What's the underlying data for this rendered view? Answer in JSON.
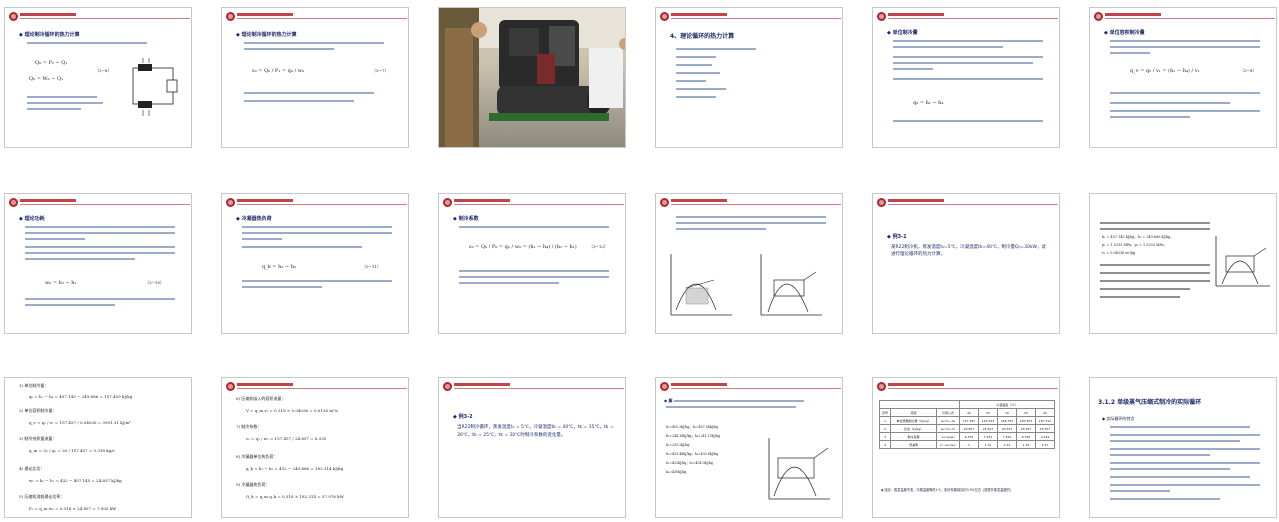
{
  "slides": [
    {
      "id": 1,
      "title": "◆ 理论制冷循环的热力计算",
      "eqs": [
        "Q₀ = P₂ − Q₁",
        "Q₀ = W₀ − Q₁",
        "（3−6）"
      ]
    },
    {
      "id": 2,
      "title": "◆ 理论制冷循环的热力计算",
      "eqs": [
        "ε₀ = Q₀ / P₁ = q₀ / w₀",
        "（3−7）"
      ]
    },
    {
      "id": 3,
      "title": ""
    },
    {
      "id": 4,
      "title": "4、理论循环的热力计算"
    },
    {
      "id": 5,
      "title": "◆ 单位制冷量",
      "eqs": [
        "q₀ = h₁ − h₄"
      ]
    },
    {
      "id": 6,
      "title": "◆ 单位容积制冷量",
      "eqs": [
        "q_v = q₀ / v₁ = (h₁ − h₄) / v₁",
        "（3−8）"
      ]
    },
    {
      "id": 7,
      "title": "◆ 理论功耗",
      "eqs": [
        "w₀ = h₂ − h₁",
        "（3−10）"
      ]
    },
    {
      "id": 8,
      "title": "◆ 冷凝器热负荷",
      "eqs": [
        "q_k = h₂ − h₃",
        "（3−11）"
      ]
    },
    {
      "id": 9,
      "title": "◆ 制冷系数",
      "eqs": [
        "ε₀ = Q₀ / P₀ = q₀ / w₀ = (h₁ − h₄) / (h₂ − h₁)",
        "（3−12）"
      ]
    },
    {
      "id": 10,
      "title": ""
    },
    {
      "id": 11,
      "title": "◆ 例3-1",
      "body": "某R22制冷机，蒸发温度t₀=5℃，冷凝温度tk=40℃，制冷量Q₀=30kW，试进行理论循环的热力计算。"
    },
    {
      "id": 12,
      "title": "",
      "eqs": [
        "h₁ = 407.145 kJ/kg，h₃ = 249.686 kJ/kg，",
        "p₁ = 1.5335 MPa，p₂ = 1.5335 MPa，",
        "v₁ = 0.04036 m³/kg"
      ]
    },
    {
      "id": 13,
      "title": "",
      "eqs": [
        "1) 单位制冷量：",
        "q₀ = h₁ − h₄ = 407.145 − 249.686 = 157.459 kJ/kg",
        "2) 单位容积制冷量：",
        "q_v = q₀ / v₁ = 157.457 / 0.04036 = 3901.31 kJ/m³",
        "3) 制冷剂质量流量：",
        "q_m = Q₀ / q₀ = 30 / 157.457 = 0.318 kg/s",
        "4) 理论比功：",
        "w₀ = h₂ − h₁ = 432 − 407.145 = 24.857 kJ/kg",
        "5) 压缩机消耗理论功率：",
        "P₀ = q_m w₀ = 0.318 × 24.857 = 7.905 kW"
      ]
    },
    {
      "id": 14,
      "title": "",
      "eqs": [
        "6) 压缩机吸入的容积流量：",
        "V = q_m v₁ = 0.318 × 0.04036 = 0.0128 m³/s",
        "7) 制冷系数：",
        "ε₀ = q₀ / w₀ = 157.457 / 24.857 = 6.335",
        "8) 冷凝器单位热负荷：",
        "q_k = h₂ − h₃ = 432 − 249.686 = 182.314 kJ/kg",
        "9) 冷凝器热负荷：",
        "Q_k = q_m q_k = 0.318 × 182.314 = 57.976 kW"
      ]
    },
    {
      "id": 15,
      "title": "◆ 例3-2",
      "body": "当R22制冷循环，蒸发温度t₀ = 5℃，冷凝温度tk = 40℃，tk = 35℃，tk = 30℃，tk = 25℃，tk = 20℃时制冷系数的变化量。"
    },
    {
      "id": 16,
      "title": "◆ 解",
      "eqs": [
        "h₂=405.3kJ/kg；h₁=407.04kJ/kg",
        "h₃=244.16kJ/kg；h₄=241.15kJ/kg",
        "h₂=239.2kJ/kg",
        "h₃=429.46kJ/kg；h₄=430.6kJ/kg",
        "h₂=432kJ/kg；h₃=434.9kJ/kg",
        "h₄=430kJ/kg"
      ]
    },
    {
      "id": 17,
      "title": "",
      "table": {
        "header_top": [
          "冷凝温度（℃）"
        ],
        "header": [
          "序号",
          "项目",
          "计算公式",
          "40",
          "35",
          "30",
          "25",
          "20"
        ],
        "rows": [
          [
            "1",
            "单位质量制冷量（kJ/kg）",
            "q₀=h₁−h₄",
            "157.457",
            "163.193",
            "168.752",
            "180.353",
            "187.312"
          ],
          [
            "2",
            "比功（kJ/kg）",
            "w₀=h₂−h₁",
            "24.857",
            "22.407",
            "20.347",
            "18.357",
            "16.357"
          ],
          [
            "3",
            "制冷系数",
            "ε₀=q₀/w₀",
            "6.335",
            "7.261",
            "7.462",
            "8.765",
            "9.249"
          ],
          [
            "4",
            "增减率",
            "(ε−ε₄₀)/ε₄₀",
            "1",
            "1.15",
            "1.22",
            "1.34",
            "1.47"
          ]
        ],
        "note": "◆ 结论：蒸发温度不变，冷凝温度降低1℃，制冷系数增加约3.5%左右（是提升蒸发温度的）"
      }
    },
    {
      "id": 18,
      "title": "3.1.2  单级蒸气压缩式制冷的实际循环",
      "sub": "◆ 实际循环的特点"
    }
  ]
}
